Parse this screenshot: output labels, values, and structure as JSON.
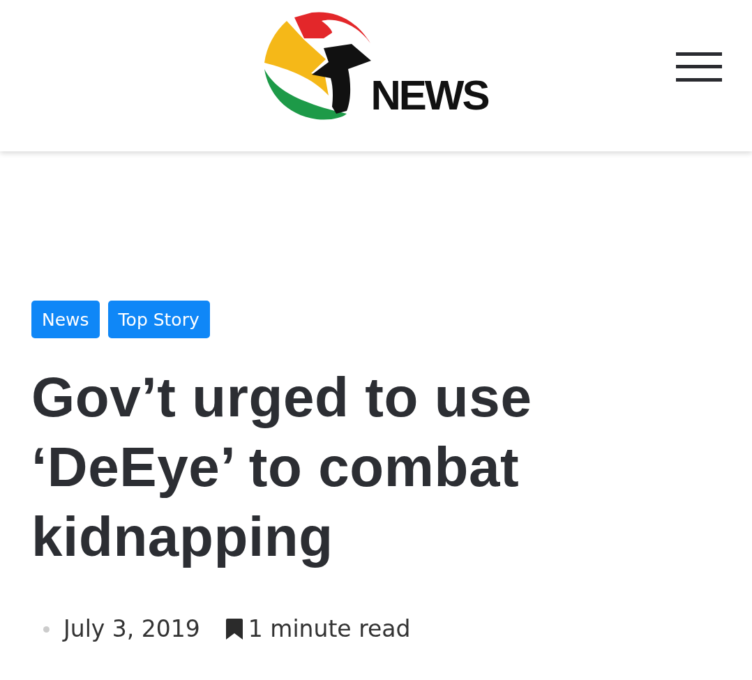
{
  "header": {
    "logo_text": "NEWS"
  },
  "article": {
    "categories": [
      "News",
      "Top Story"
    ],
    "headline": "Gov’t urged to use ‘DeEye’ to combat kidnapping",
    "date": "July 3, 2019",
    "read_time": "1 minute read"
  }
}
